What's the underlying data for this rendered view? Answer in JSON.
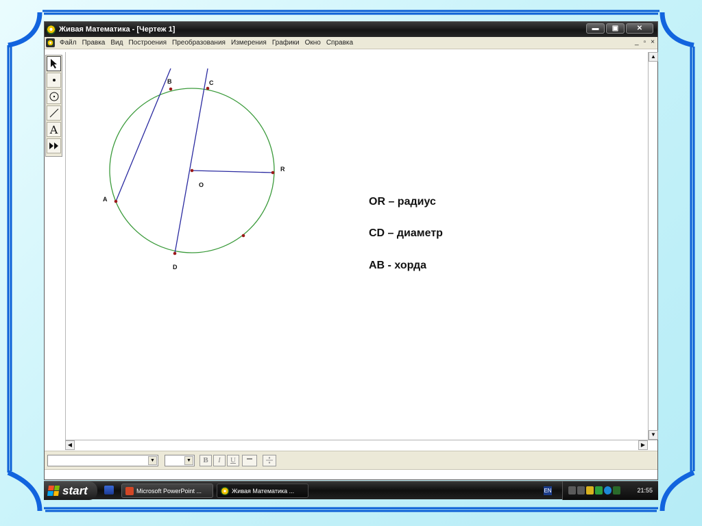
{
  "window": {
    "title": "Живая Математика - [Чертеж 1]",
    "controls": [
      "minimize-icon",
      "maximize-icon",
      "close-icon"
    ]
  },
  "menu": {
    "items": [
      "Файл",
      "Правка",
      "Вид",
      "Построения",
      "Преобразования",
      "Измерения",
      "Графики",
      "Окно",
      "Справка"
    ],
    "mdi_controls": [
      "_",
      "▫",
      "×"
    ]
  },
  "toolbox": {
    "tools": [
      "arrow-select-tool",
      "point-tool",
      "compass-tool",
      "segment-tool",
      "text-tool",
      "custom-tool"
    ],
    "text_tool_label": "A"
  },
  "drawing": {
    "points": {
      "A": "A",
      "B": "B",
      "C": "C",
      "D": "D",
      "O": "O",
      "R": "R"
    },
    "circle_color": "#3a9a3a",
    "segment_color": "#2a2aa0",
    "point_color": "#9b1a1a"
  },
  "captions": {
    "radius": "OR – радиус",
    "diameter": "CD – диаметр",
    "chord": "AB - хорда"
  },
  "formatbar": {
    "bold": "B",
    "italic": "I",
    "underline": "U"
  },
  "taskbar": {
    "start_label": "start",
    "tasks": [
      {
        "label": "Microsoft PowerPoint ...",
        "icon": "powerpoint-icon"
      },
      {
        "label": "Живая Математика ...",
        "icon": "sketchpad-icon"
      }
    ],
    "language": "EN",
    "clock": "21:55"
  }
}
